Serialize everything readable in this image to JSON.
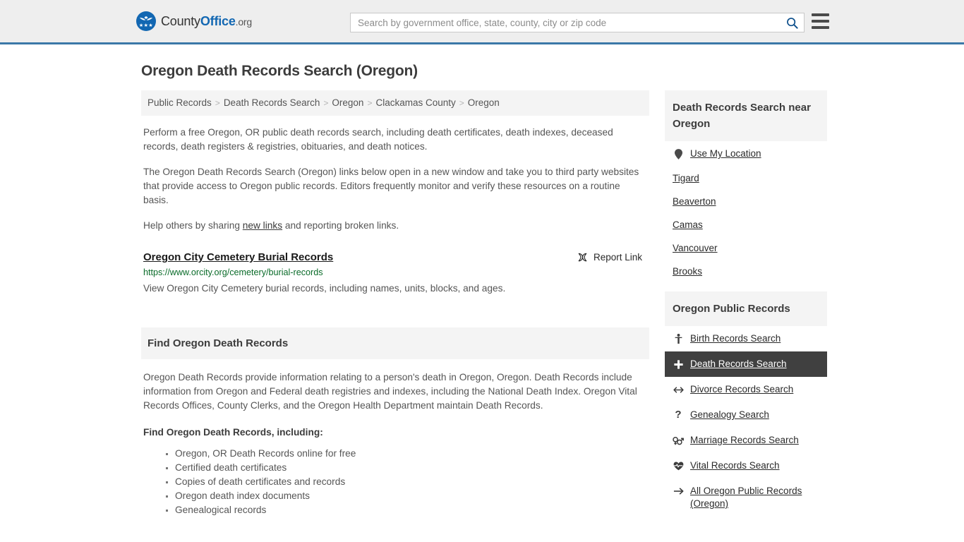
{
  "header": {
    "brand": {
      "part1": "County",
      "part2": "Office",
      "part3": ".org",
      "logo_icon": "countyoffice-eagle-logo"
    },
    "search": {
      "placeholder": "Search by government office, state, county, city or zip code",
      "value": "",
      "icon": "search-icon"
    },
    "menu_icon": "hamburger-menu-icon",
    "accent_color": "#3b78a8"
  },
  "page": {
    "title": "Oregon Death Records Search (Oregon)"
  },
  "breadcrumb": {
    "separator": ">",
    "items": [
      {
        "label": "Public Records"
      },
      {
        "label": "Death Records Search"
      },
      {
        "label": "Oregon"
      },
      {
        "label": "Clackamas County"
      },
      {
        "label": "Oregon"
      }
    ]
  },
  "intro": {
    "p1": "Perform a free Oregon, OR public death records search, including death certificates, death indexes, deceased records, death registers & registries, obituaries, and death notices.",
    "p2": "The Oregon Death Records Search (Oregon) links below open in a new window and take you to third party websites that provide access to Oregon public records. Editors frequently monitor and verify these resources on a routine basis.",
    "p3_before": "Help others by sharing ",
    "p3_link": "new links",
    "p3_after": " and reporting broken links."
  },
  "result": {
    "title": "Oregon City Cemetery Burial Records",
    "url": "https://www.orcity.org/cemetery/burial-records",
    "description": "View Oregon City Cemetery burial records, including names, units, blocks, and ages.",
    "report_label": "Report Link",
    "report_icon": "broken-link-icon",
    "url_color": "#0a6b29"
  },
  "section": {
    "heading": "Find Oregon Death Records",
    "paragraph": "Oregon Death Records provide information relating to a person's death in Oregon, Oregon. Death Records include information from Oregon and Federal death registries and indexes, including the National Death Index. Oregon Vital Records Offices, County Clerks, and the Oregon Health Department maintain Death Records.",
    "list_heading": "Find Oregon Death Records, including:",
    "list_items": [
      "Oregon, OR Death Records online for free",
      "Certified death certificates",
      "Copies of death certificates and records",
      "Oregon death index documents",
      "Genealogical records"
    ]
  },
  "sidebar": {
    "nearby": {
      "heading": "Death Records Search near Oregon",
      "use_location": {
        "label": "Use My Location",
        "icon": "map-pin-icon"
      },
      "cities": [
        {
          "label": "Tigard"
        },
        {
          "label": "Beaverton"
        },
        {
          "label": "Camas"
        },
        {
          "label": "Vancouver"
        },
        {
          "label": "Brooks"
        }
      ]
    },
    "public_records": {
      "heading": "Oregon Public Records",
      "items": [
        {
          "label": "Birth Records Search",
          "icon": "baby-icon",
          "active": false
        },
        {
          "label": "Death Records Search",
          "icon": "cross-plus-icon",
          "active": true
        },
        {
          "label": "Divorce Records Search",
          "icon": "arrows-left-right-icon",
          "active": false
        },
        {
          "label": "Genealogy Search",
          "icon": "question-mark-icon",
          "active": false
        },
        {
          "label": "Marriage Records Search",
          "icon": "venus-mars-icon",
          "active": false
        },
        {
          "label": "Vital Records Search",
          "icon": "heartbeat-icon",
          "active": false
        },
        {
          "label": "All Oregon Public Records (Oregon)",
          "icon": "arrow-right-icon",
          "active": false
        }
      ],
      "active_bg": "#404040"
    }
  }
}
